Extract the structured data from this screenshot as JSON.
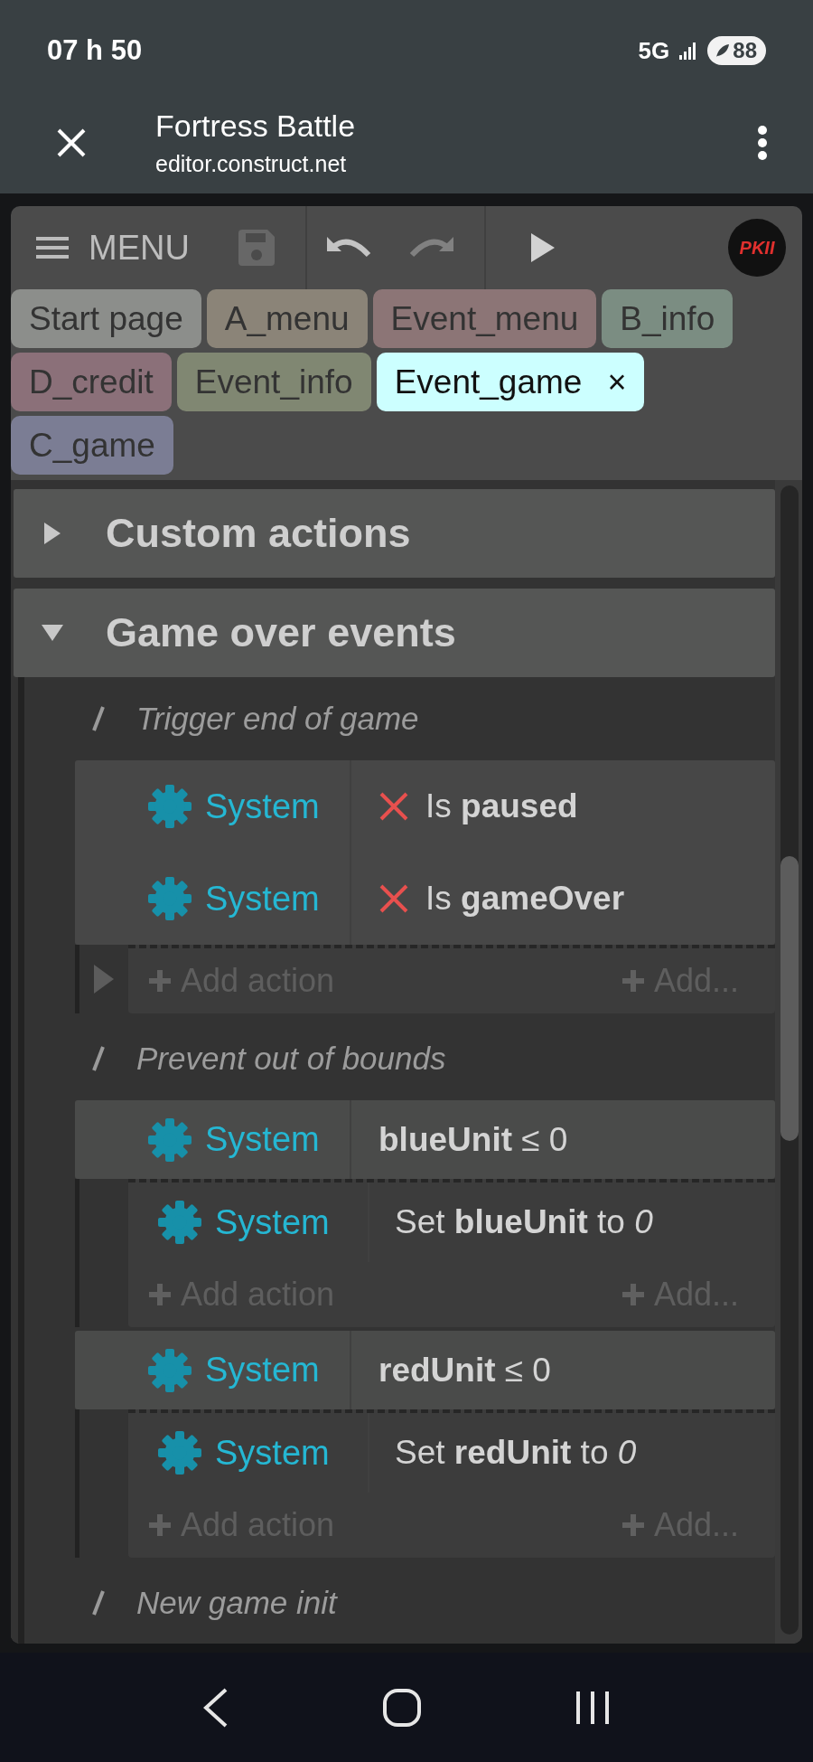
{
  "status_bar": {
    "time": "07 h 50",
    "network": "5G",
    "battery": "88"
  },
  "browser": {
    "title": "Fortress Battle",
    "url": "editor.construct.net"
  },
  "toolbar": {
    "menu": "MENU",
    "save_disabled": true,
    "undo_disabled": false,
    "redo_disabled": true,
    "avatar": "PKII"
  },
  "tab_rows": [
    [
      {
        "label": "Start page",
        "color": "#8c8e8b",
        "selected": false
      },
      {
        "label": "A_menu",
        "color": "#8b8478",
        "selected": false
      },
      {
        "label": "Event_menu",
        "color": "#8c7576",
        "selected": false
      },
      {
        "label": "B_info",
        "color": "#7b8d82",
        "selected": false
      }
    ],
    [
      {
        "label": "D_credit",
        "color": "#8b7079",
        "selected": false
      },
      {
        "label": "Event_info",
        "color": "#808772",
        "selected": false
      },
      {
        "label": "Event_game",
        "color": "#ccffff",
        "selected": true,
        "close": "×"
      }
    ],
    [
      {
        "label": "C_game",
        "color": "#7b7d94",
        "selected": false
      }
    ]
  ],
  "sheet": [
    {
      "kind": "group",
      "title": "Custom actions",
      "expanded": false
    },
    {
      "kind": "group",
      "title": "Game over events",
      "expanded": true,
      "children": [
        {
          "kind": "comment",
          "text": "Trigger end of game"
        },
        {
          "kind": "event",
          "marker": true,
          "conditions": [
            {
              "object": "System",
              "inverted": true,
              "text": "Is **paused**"
            },
            {
              "object": "System",
              "inverted": true,
              "text": "Is **gameOver**"
            }
          ],
          "add_action": "Add action",
          "add_more": "Add..."
        },
        {
          "kind": "comment",
          "text": "Prevent out of bounds"
        },
        {
          "kind": "event",
          "marker": false,
          "conditions": [
            {
              "object": "System",
              "inverted": false,
              "text": "**blueUnit** ≤ 0"
            }
          ],
          "actions": [
            {
              "object": "System",
              "text": "Set **blueUnit** to *0*"
            }
          ],
          "add_action": "Add action",
          "add_more": "Add..."
        },
        {
          "kind": "event",
          "marker": false,
          "conditions": [
            {
              "object": "System",
              "inverted": false,
              "text": "**redUnit** ≤ 0"
            }
          ],
          "actions": [
            {
              "object": "System",
              "text": "Set **redUnit** to *0*"
            }
          ],
          "add_action": "Add action",
          "add_more": "Add..."
        },
        {
          "kind": "comment",
          "text": "New game init"
        }
      ]
    }
  ]
}
